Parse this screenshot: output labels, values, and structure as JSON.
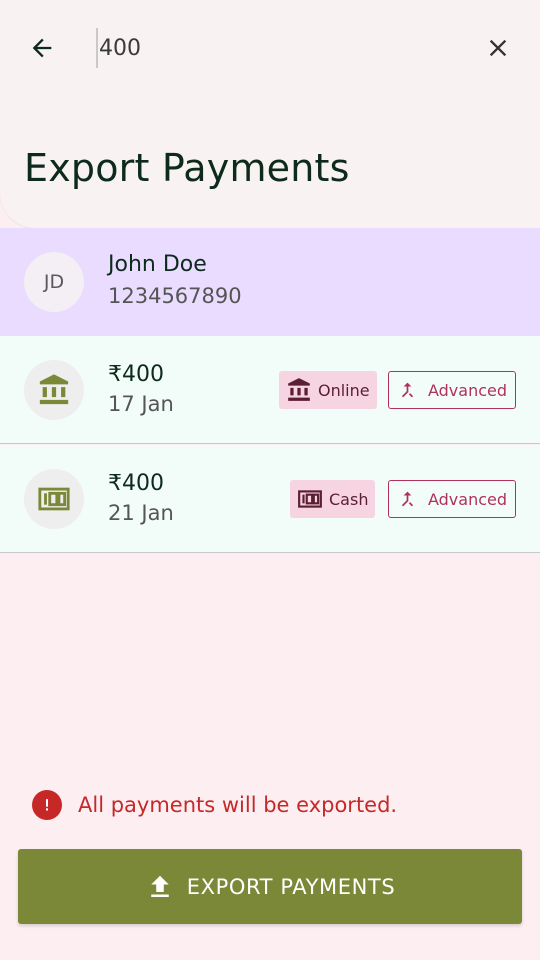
{
  "search": {
    "value": "400"
  },
  "header": {
    "title": "Export Payments"
  },
  "customer": {
    "initials": "JD",
    "name": "John Doe",
    "phone": "1234567890"
  },
  "payments": [
    {
      "amount": "₹400",
      "date": "17 Jan",
      "mode": "Online",
      "mode_icon": "bank-icon",
      "tag": "Advanced"
    },
    {
      "amount": "₹400",
      "date": "21 Jan",
      "mode": "Cash",
      "mode_icon": "cash-icon",
      "tag": "Advanced"
    }
  ],
  "info": {
    "text": "All payments will be exported."
  },
  "export_button": {
    "label": "EXPORT PAYMENTS"
  },
  "colors": {
    "primary": "#7b8838",
    "error": "#c62828",
    "accent": "#b0325a",
    "customer_bg": "#e9dcff"
  }
}
